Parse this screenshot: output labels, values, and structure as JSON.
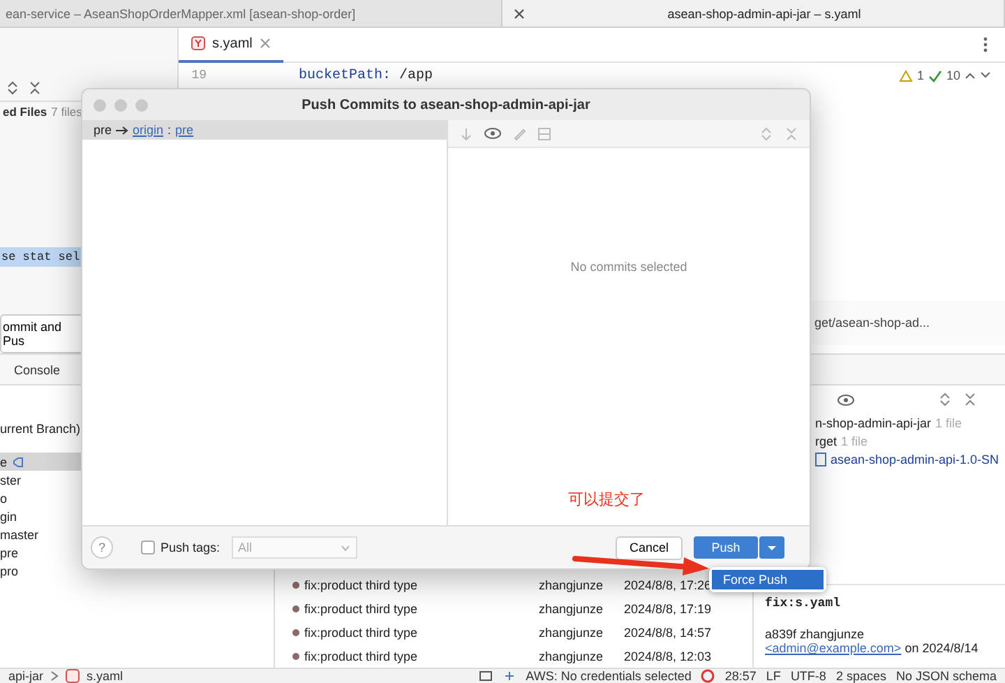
{
  "window_tabs": [
    {
      "title": "ean-service – AseanShopOrderMapper.xml [asean-shop-order]",
      "selected": false
    },
    {
      "title": "asean-shop-admin-api-jar – s.yaml",
      "selected": true
    }
  ],
  "editor": {
    "tab": "s.yaml",
    "line_number": "19",
    "key": "bucketPath:",
    "value": "/app",
    "warnings": "1",
    "checks": "10",
    "path_hint": "get/asean-shop-ad..."
  },
  "commit_panel": {
    "changes_label": "ed Files",
    "changes_count": "7 files",
    "message": "se stat sel",
    "commit_button": "ommit and Pus"
  },
  "git_window": {
    "console_tab": "Console"
  },
  "branches": {
    "header": "urrent Branch)",
    "items": [
      {
        "label": "e",
        "selected": true
      },
      {
        "label": "ster",
        "selected": false
      },
      {
        "label": "o",
        "selected": false
      },
      {
        "label": "gin",
        "selected": false
      },
      {
        "label": "master",
        "selected": false
      },
      {
        "label": "pre",
        "selected": false
      },
      {
        "label": "pro",
        "selected": false
      }
    ]
  },
  "log": [
    {
      "message": "fix:product third type",
      "author": "zhangjunze",
      "date": "2024/8/8, 17:26"
    },
    {
      "message": "fix:product third type",
      "author": "zhangjunze",
      "date": "2024/8/8, 17:19"
    },
    {
      "message": "fix:product third type",
      "author": "zhangjunze",
      "date": "2024/8/8, 14:57"
    },
    {
      "message": "fix:product third type",
      "author": "zhangjunze",
      "date": "2024/8/8, 12:03"
    }
  ],
  "details": {
    "files": [
      {
        "kind": "folder",
        "name": "n-shop-admin-api-jar",
        "count": "1 file"
      },
      {
        "kind": "folder",
        "name": "rget",
        "count": "1 file"
      },
      {
        "kind": "file",
        "name": "asean-shop-admin-api-1.0-SN"
      }
    ],
    "subject": "fix:s.yaml",
    "hash_author": "a839f zhangjunze",
    "email": "<admin@example.com>",
    "date_text": "on 2024/8/14"
  },
  "status_bar": {
    "breadcrumb": [
      "api-jar",
      "s.yaml"
    ],
    "aws": "AWS: No credentials selected",
    "position": "28:57",
    "line_ending": "LF",
    "encoding": "UTF-8",
    "indent": "2 spaces",
    "schema": "No JSON schema"
  },
  "dialog": {
    "title": "Push Commits to asean-shop-admin-api-jar",
    "local_branch": "pre",
    "remote": "origin",
    "remote_branch": "pre",
    "separator": ":",
    "help": "?",
    "empty_text": "No commits selected",
    "push_tags": {
      "label": "Push tags:",
      "checked": false,
      "value": "All"
    },
    "annotation": "可以提交了",
    "cancel": "Cancel",
    "push": "Push",
    "menu": [
      {
        "label": "Force Push",
        "selected": true
      }
    ]
  }
}
